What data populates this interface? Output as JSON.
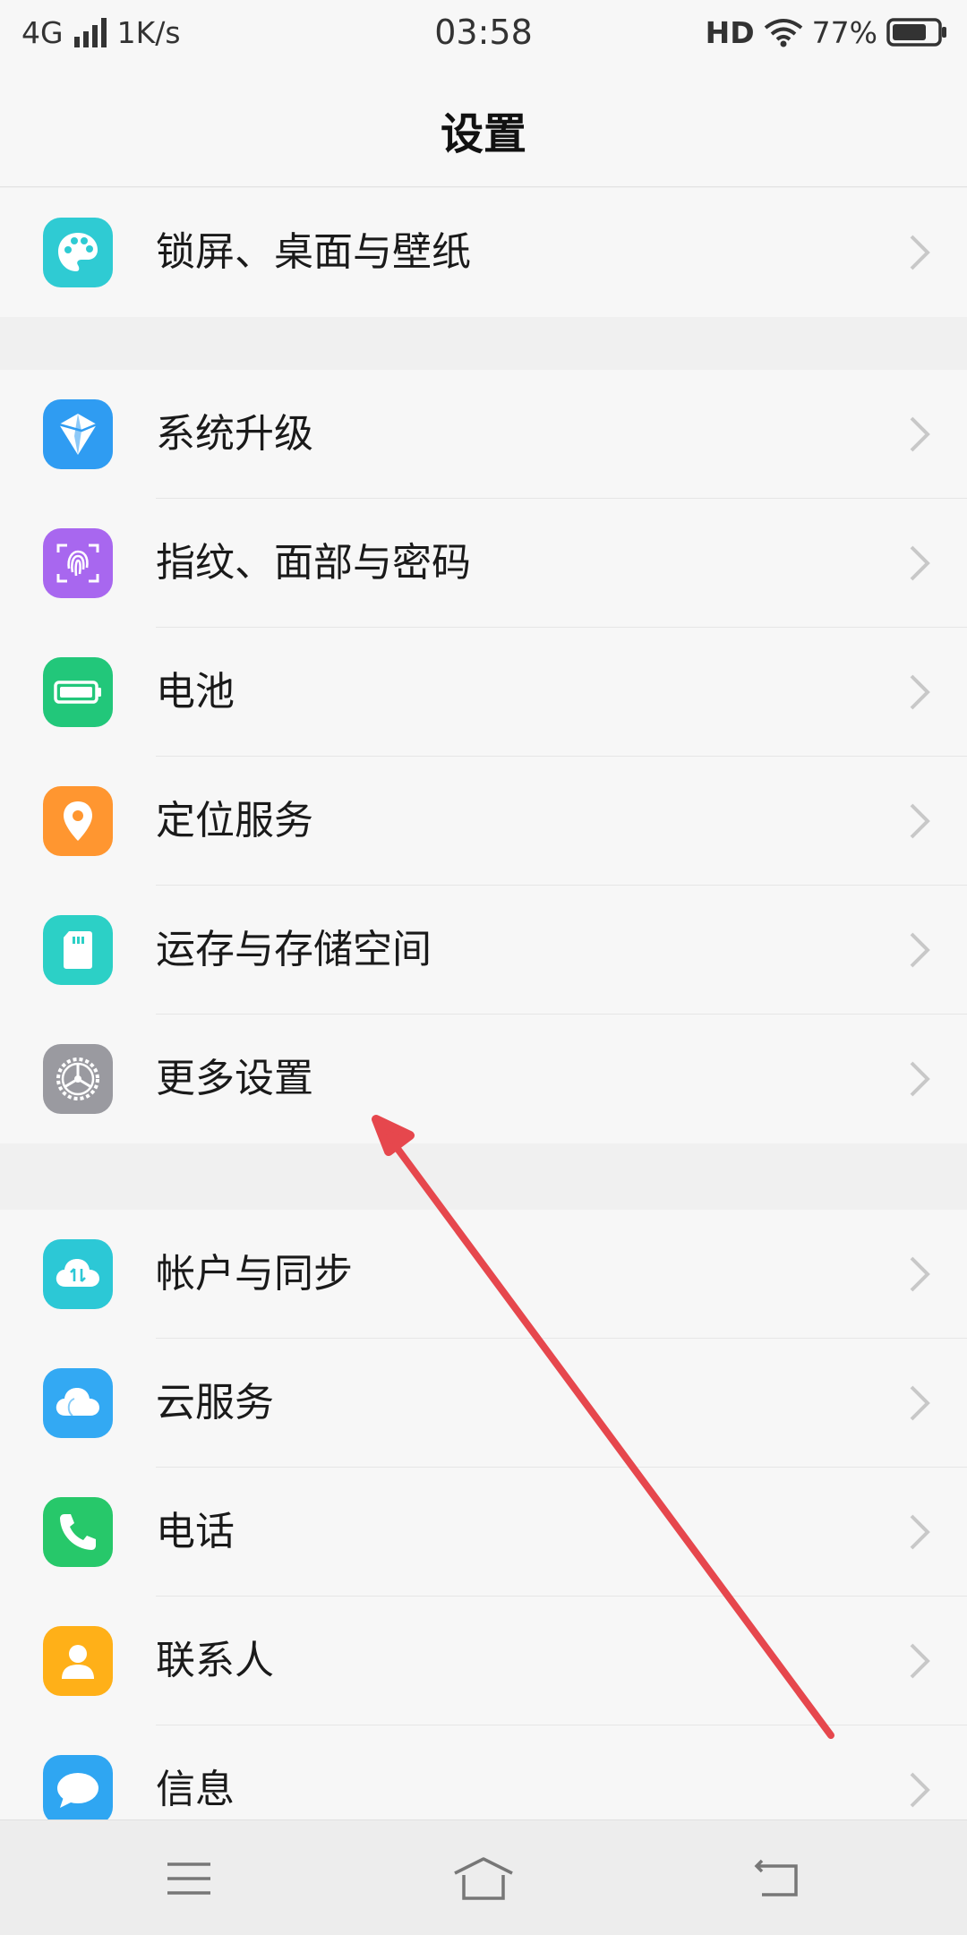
{
  "status_bar": {
    "network": "4G",
    "speed": "1K/s",
    "time": "03:58",
    "hd": "HD",
    "battery": "77%",
    "battery_level": 0.77
  },
  "header": {
    "title": "设置"
  },
  "groups": [
    {
      "items": [
        {
          "label": "锁屏、桌面与壁纸",
          "icon": "palette-icon",
          "color": "#2fcbd3"
        }
      ]
    },
    {
      "items": [
        {
          "label": "系统升级",
          "icon": "system-upgrade-icon",
          "color": "#2f9cf2"
        },
        {
          "label": "指纹、面部与密码",
          "icon": "fingerprint-icon",
          "color": "#a867ef"
        },
        {
          "label": "电池",
          "icon": "battery-icon",
          "color": "#22c77a"
        },
        {
          "label": "定位服务",
          "icon": "location-pin-icon",
          "color": "#ff9630"
        },
        {
          "label": "运存与存储空间",
          "icon": "sd-card-icon",
          "color": "#2cd0c6"
        },
        {
          "label": "更多设置",
          "icon": "gear-icon",
          "color": "#9a9aa0"
        }
      ]
    },
    {
      "items": [
        {
          "label": "帐户与同步",
          "icon": "cloud-sync-icon",
          "color": "#2cc8d6"
        },
        {
          "label": "云服务",
          "icon": "cloud-icon",
          "color": "#33a9f3"
        },
        {
          "label": "电话",
          "icon": "phone-icon",
          "color": "#27c86a"
        },
        {
          "label": "联系人",
          "icon": "contact-icon",
          "color": "#ffb018"
        },
        {
          "label": "信息",
          "icon": "message-icon",
          "color": "#2fa6f2"
        }
      ]
    }
  ],
  "annotation": {
    "type": "arrow",
    "color": "#e6474d"
  },
  "nav_bar": {
    "buttons": [
      {
        "name": "menu-icon"
      },
      {
        "name": "home-icon"
      },
      {
        "name": "back-icon"
      }
    ]
  }
}
